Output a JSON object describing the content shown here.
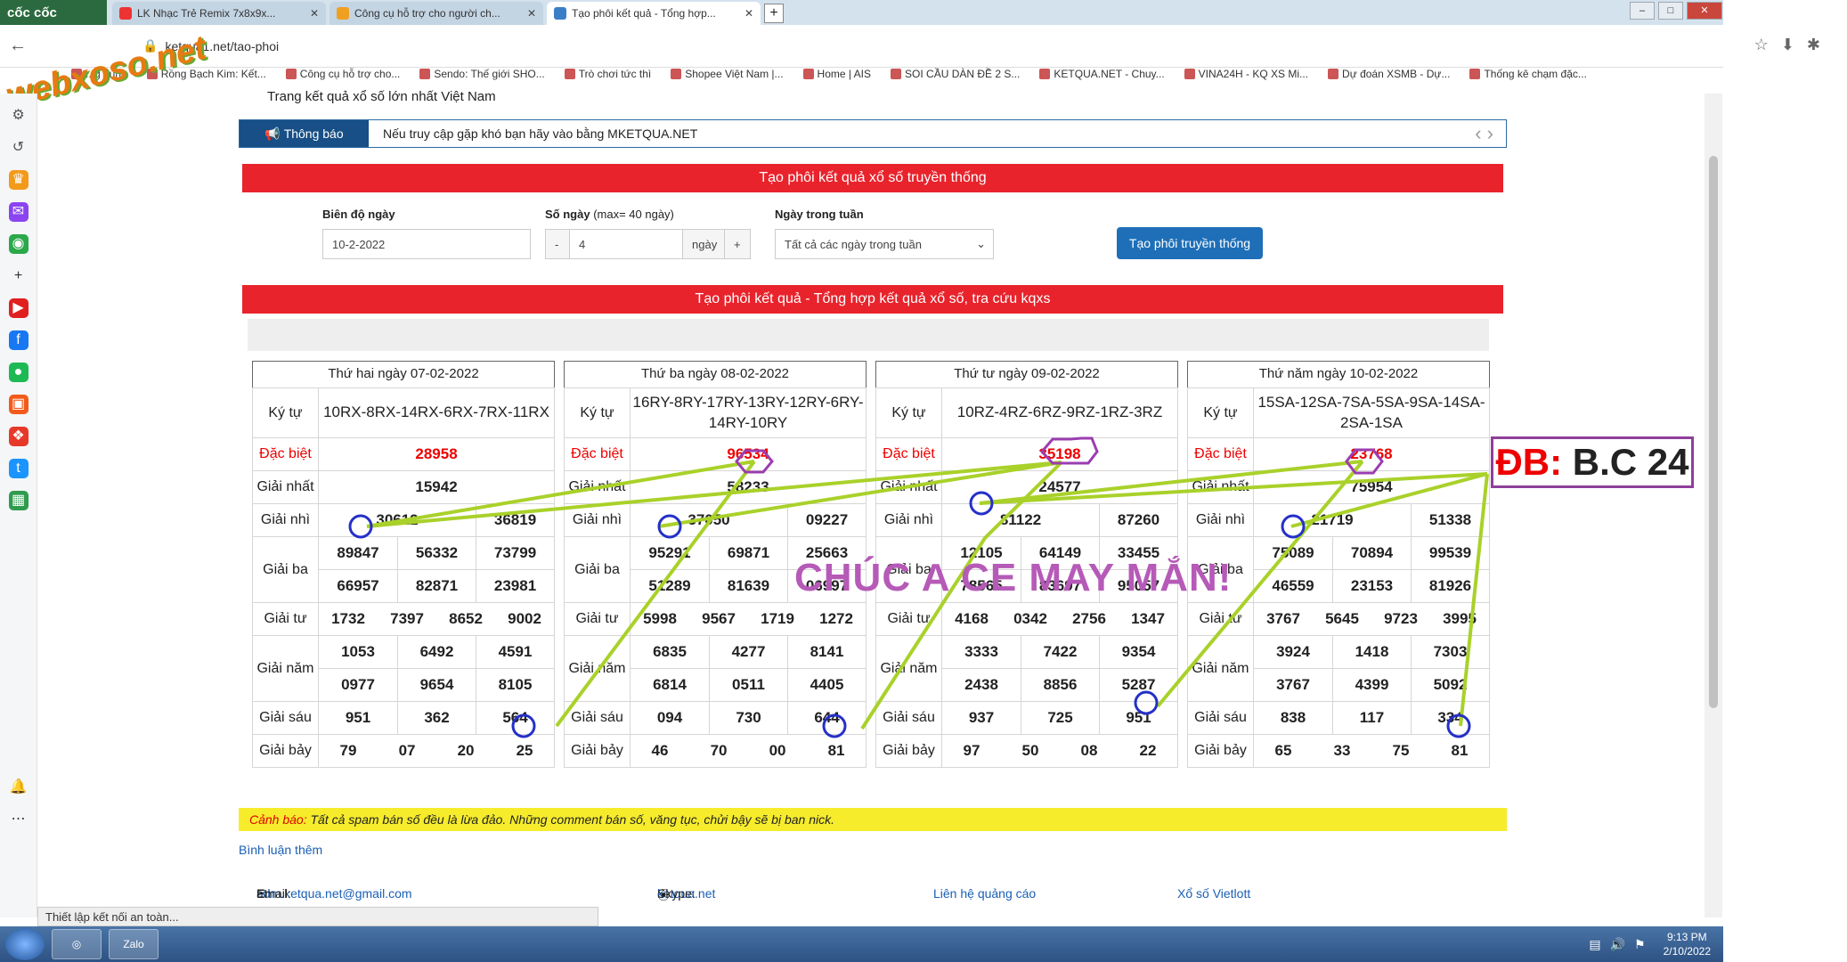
{
  "browser": {
    "brand": "cốc cốc",
    "tabs": [
      {
        "title": "LK Nhạc Trẻ Remix 7x8x9x..."
      },
      {
        "title": "Công cụ hỗ trợ cho người ch..."
      },
      {
        "title": "Tạo phôi kết quả - Tổng hợp..."
      }
    ],
    "url": "ketqua1.net/tao-phoi",
    "bookmarks": [
      "...g dụng",
      "Rồng Bạch Kim: Kết...",
      "Công cụ hỗ trợ cho...",
      "Sendo: Thế giới SHO...",
      "Trò chơi tức thì",
      "Shopee Việt Nam |...",
      "Home | AIS",
      "SOI CẦU DÀN ĐỀ 2 S...",
      "KETQUA.NET - Chuy...",
      "VINA24H - KQ XS Mi...",
      "Dự đoán XSMB - Dự...",
      "Thống kê chạm đặc..."
    ],
    "status": "Thiết lập kết nối an toàn..."
  },
  "watermark": "webxoso.net",
  "page": {
    "site_title": "Trang kết quả xổ số lớn nhất Việt Nam",
    "notice_label": "Thông báo",
    "notice_text": "Nếu truy cập gặp khó bạn hãy vào bằng MKETQUA.NET",
    "section1_title": "Tạo phôi kết quả xổ số truyền thống",
    "form": {
      "range_label": "Biên độ ngày",
      "range_value": "10-2-2022",
      "days_label": "Số ngày",
      "days_note": "(max= 40 ngày)",
      "days_minus": "-",
      "days_value": "4",
      "days_unit": "ngày",
      "days_plus": "+",
      "weekday_label": "Ngày trong tuần",
      "weekday_value": "Tất cả các ngày trong tuần",
      "submit": "Tạo phôi truyền thống"
    },
    "section2_title": "Tạo phôi kết quả - Tổng hợp kết quả xổ số, tra cứu kqxs",
    "row_labels": {
      "ky": "Ký tự",
      "db": "Đặc biệt",
      "g1": "Giải nhất",
      "g2": "Giải nhì",
      "g3": "Giải ba",
      "g4": "Giải tư",
      "g5": "Giải năm",
      "g6": "Giải sáu",
      "g7": "Giải bảy"
    },
    "days": [
      {
        "title": "Thứ hai ngày 07-02-2022",
        "ky": "10RX-8RX-14RX-6RX-7RX-11RX",
        "db": "28958",
        "g1": "15942",
        "g2": [
          "30612",
          "36819"
        ],
        "g3": [
          "89847",
          "56332",
          "73799",
          "66957",
          "82871",
          "23981"
        ],
        "g4": [
          "1732",
          "7397",
          "8652",
          "9002"
        ],
        "g5": [
          "1053",
          "6492",
          "4591",
          "0977",
          "9654",
          "8105"
        ],
        "g6": [
          "951",
          "362",
          "564"
        ],
        "g7": [
          "79",
          "07",
          "20",
          "25"
        ]
      },
      {
        "title": "Thứ ba ngày 08-02-2022",
        "ky": "16RY-8RY-17RY-13RY-12RY-6RY-14RY-10RY",
        "db": "96534",
        "g1": "58233",
        "g2": [
          "37050",
          "09227"
        ],
        "g3": [
          "95291",
          "69871",
          "25663",
          "51289",
          "81639",
          "06997"
        ],
        "g4": [
          "5998",
          "9567",
          "1719",
          "1272"
        ],
        "g5": [
          "6835",
          "4277",
          "8141",
          "6814",
          "0511",
          "4405"
        ],
        "g6": [
          "094",
          "730",
          "644"
        ],
        "g7": [
          "46",
          "70",
          "00",
          "81"
        ]
      },
      {
        "title": "Thứ tư ngày 09-02-2022",
        "ky": "10RZ-4RZ-6RZ-9RZ-1RZ-3RZ",
        "db": "35198",
        "g1": "24577",
        "g2": [
          "81122",
          "87260"
        ],
        "g3": [
          "12105",
          "64149",
          "33455",
          "78565",
          "83697",
          "95057"
        ],
        "g4": [
          "4168",
          "0342",
          "2756",
          "1347"
        ],
        "g5": [
          "3333",
          "7422",
          "9354",
          "2438",
          "8856",
          "5287"
        ],
        "g6": [
          "937",
          "725",
          "951"
        ],
        "g7": [
          "97",
          "50",
          "08",
          "22"
        ]
      },
      {
        "title": "Thứ năm ngày 10-02-2022",
        "ky": "15SA-12SA-7SA-5SA-9SA-14SA-2SA-1SA",
        "db": "23768",
        "g1": "75954",
        "g2": [
          "21719",
          "51338"
        ],
        "g3": [
          "75089",
          "70894",
          "99539",
          "46559",
          "23153",
          "81926"
        ],
        "g4": [
          "3767",
          "5645",
          "9723",
          "3995"
        ],
        "g5": [
          "3924",
          "1418",
          "7303",
          "3767",
          "4399",
          "5092"
        ],
        "g6": [
          "838",
          "117",
          "334"
        ],
        "g7": [
          "65",
          "33",
          "75",
          "81"
        ]
      }
    ],
    "annotation_text": "CHÚC A  CE MAY MẮN!",
    "db_box": {
      "prefix": "ĐB:",
      "value": "B.C 24"
    },
    "warning_label": "Cảnh báo:",
    "warning_text": "Tất cả spam bán số đều là lừa đảo. Những comment bán số, văng tục, chửi bậy sẽ bị ban nick.",
    "comments_link": "Bình luận thêm",
    "footer": {
      "email_label": "Email:",
      "email": "adm.ketqua.net@gmail.com",
      "skype_label": "Skype:",
      "skype": "ketqua.net",
      "ads": "Liên hệ quảng cáo",
      "vietlott": "Xổ số Vietlott"
    }
  },
  "taskbar": {
    "app": "Zalo",
    "time": "9:13 PM",
    "date": "2/10/2022"
  }
}
